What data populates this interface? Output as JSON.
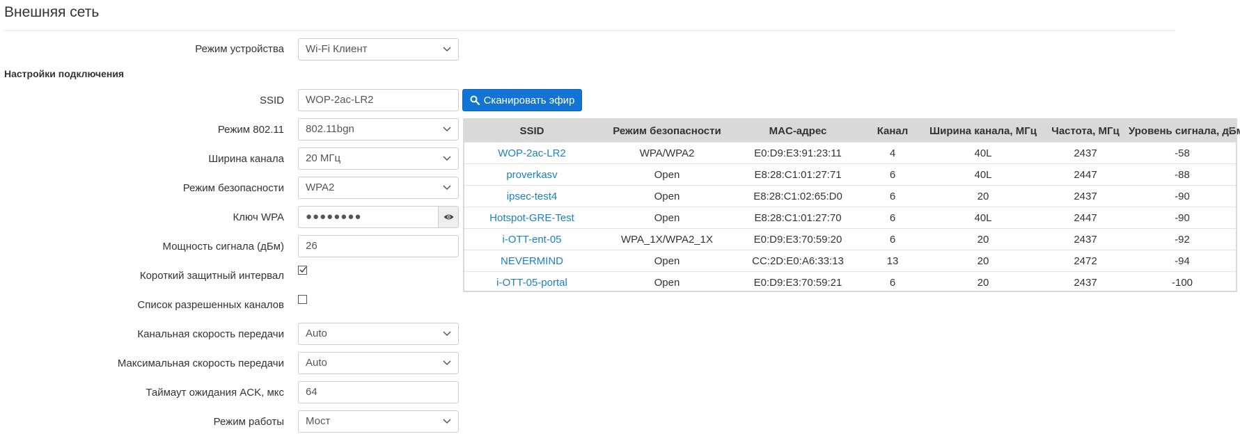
{
  "page": {
    "title": "Внешняя сеть",
    "section_title": "Настройки подключения"
  },
  "form": {
    "device_mode": {
      "label": "Режим устройства",
      "value": "Wi-Fi Клиент"
    },
    "ssid": {
      "label": "SSID",
      "value": "WOP-2ac-LR2"
    },
    "scan_button": {
      "label": "Сканировать эфир",
      "icon": "search-icon"
    },
    "mode_80211": {
      "label": "Режим 802.11",
      "value": "802.11bgn"
    },
    "channel_width": {
      "label": "Ширина канала",
      "value": "20 МГц"
    },
    "security_mode": {
      "label": "Режим безопасности",
      "value": "WPA2"
    },
    "wpa_key": {
      "label": "Ключ WPA",
      "value": "●●●●●●●●",
      "icon": "eye-icon"
    },
    "tx_power": {
      "label": "Мощность сигнала (дБм)",
      "value": "26"
    },
    "short_gi": {
      "label": "Короткий защитный интервал",
      "checked": true
    },
    "allowed_channels": {
      "label": "Список разрешенных каналов",
      "checked": false
    },
    "channel_rate": {
      "label": "Канальная скорость передачи",
      "value": "Auto"
    },
    "max_rate": {
      "label": "Максимальная скорость передачи",
      "value": "Auto"
    },
    "ack_timeout": {
      "label": "Таймаут ожидания ACK, мкс",
      "value": "64"
    },
    "work_mode": {
      "label": "Режим работы",
      "value": "Мост"
    }
  },
  "scan_results": {
    "close_label": "×",
    "columns": [
      "SSID",
      "Режим безопасности",
      "MAC-адрес",
      "Канал",
      "Ширина канала, МГц",
      "Частота, МГц",
      "Уровень сигнала, дБм"
    ],
    "rows": [
      [
        "WOP-2ac-LR2",
        "WPA/WPA2",
        "E0:D9:E3:91:23:11",
        "4",
        "40L",
        "2437",
        "-58"
      ],
      [
        "proverkasv",
        "Open",
        "E8:28:C1:01:27:71",
        "6",
        "40L",
        "2447",
        "-88"
      ],
      [
        "ipsec-test4",
        "Open",
        "E8:28:C1:02:65:D0",
        "6",
        "20",
        "2437",
        "-90"
      ],
      [
        "Hotspot-GRE-Test",
        "Open",
        "E8:28:C1:01:27:70",
        "6",
        "40L",
        "2447",
        "-90"
      ],
      [
        "i-OTT-ent-05",
        "WPA_1X/WPA2_1X",
        "E0:D9:E3:70:59:20",
        "6",
        "20",
        "2437",
        "-92"
      ],
      [
        "NEVERMIND",
        "Open",
        "CC:2D:E0:A6:33:13",
        "13",
        "20",
        "2472",
        "-94"
      ],
      [
        "i-OTT-05-portal",
        "Open",
        "E0:D9:E3:70:59:21",
        "6",
        "20",
        "2437",
        "-100"
      ]
    ]
  },
  "colors": {
    "accent": "#1474d6",
    "link": "#1a7fc6",
    "table_header": "#d9d9d9"
  }
}
